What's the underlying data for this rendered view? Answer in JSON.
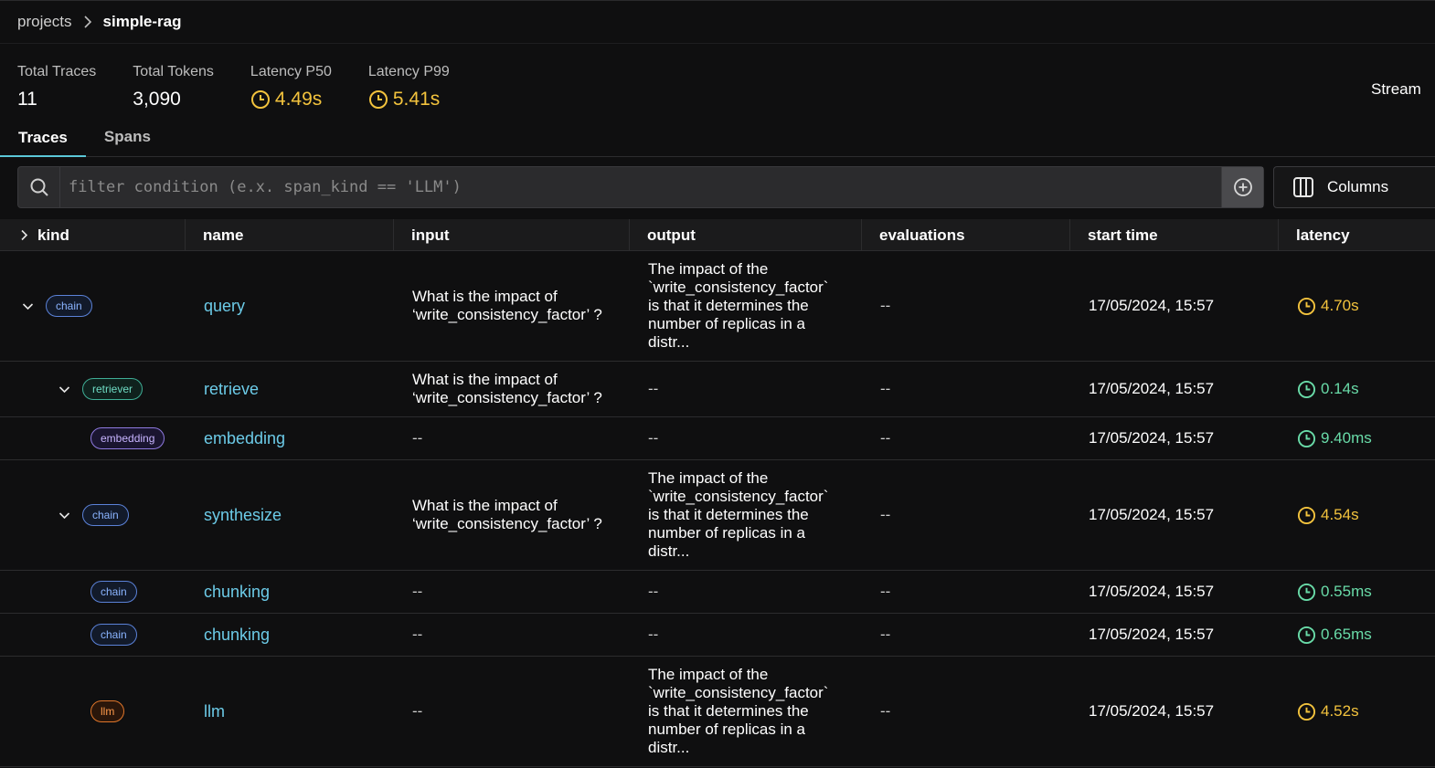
{
  "breadcrumb": {
    "project": "projects",
    "current": "simple-rag"
  },
  "stats": [
    {
      "label": "Total Traces",
      "value": "11",
      "status": "plain"
    },
    {
      "label": "Total Tokens",
      "value": "3,090",
      "status": "plain"
    },
    {
      "label": "Latency P50",
      "value": "4.49s",
      "status": "warn"
    },
    {
      "label": "Latency P99",
      "value": "5.41s",
      "status": "warn"
    }
  ],
  "stream_label": "Stream",
  "tabs": [
    {
      "label": "Traces",
      "active": true
    },
    {
      "label": "Spans",
      "active": false
    }
  ],
  "filter": {
    "placeholder": "filter condition (e.x. span_kind == 'LLM')"
  },
  "columns_button": "Columns",
  "colors": {
    "warn": "#f3c33d",
    "ok": "#69dba8",
    "link": "#6ccbe8",
    "accent": "#5bc8d8"
  },
  "table": {
    "headers": {
      "kind": "kind",
      "name": "name",
      "input": "input",
      "output": "output",
      "evaluations": "evaluations",
      "start_time": "start time",
      "latency": "latency"
    },
    "rows": [
      {
        "kind": "chain",
        "name": "query",
        "input": "What is the impact of ‘write_consistency_factor’ ?",
        "output": "The impact of the `write_consistency_factor` is that it determines the number of replicas in a distr...",
        "evaluations": "--",
        "start_time": "17/05/2024, 15:57",
        "latency": "4.70s",
        "latency_status": "warn"
      },
      {
        "kind": "retriever",
        "name": "retrieve",
        "input": "What is the impact of ‘write_consistency_factor’ ?",
        "output": "--",
        "evaluations": "--",
        "start_time": "17/05/2024, 15:57",
        "latency": "0.14s",
        "latency_status": "ok"
      },
      {
        "kind": "embedding",
        "name": "embedding",
        "input": "--",
        "output": "--",
        "evaluations": "--",
        "start_time": "17/05/2024, 15:57",
        "latency": "9.40ms",
        "latency_status": "ok"
      },
      {
        "kind": "chain",
        "name": "synthesize",
        "input": "What is the impact of ‘write_consistency_factor’ ?",
        "output": "The impact of the `write_consistency_factor` is that it determines the number of replicas in a distr...",
        "evaluations": "--",
        "start_time": "17/05/2024, 15:57",
        "latency": "4.54s",
        "latency_status": "warn"
      },
      {
        "kind": "chain",
        "name": "chunking",
        "input": "--",
        "output": "--",
        "evaluations": "--",
        "start_time": "17/05/2024, 15:57",
        "latency": "0.55ms",
        "latency_status": "ok"
      },
      {
        "kind": "chain",
        "name": "chunking",
        "input": "--",
        "output": "--",
        "evaluations": "--",
        "start_time": "17/05/2024, 15:57",
        "latency": "0.65ms",
        "latency_status": "ok"
      },
      {
        "kind": "llm",
        "name": "llm",
        "input": "--",
        "output": "The impact of the `write_consistency_factor` is that it determines the number of replicas in a distr...",
        "evaluations": "--",
        "start_time": "17/05/2024, 15:57",
        "latency": "4.52s",
        "latency_status": "warn"
      }
    ]
  }
}
